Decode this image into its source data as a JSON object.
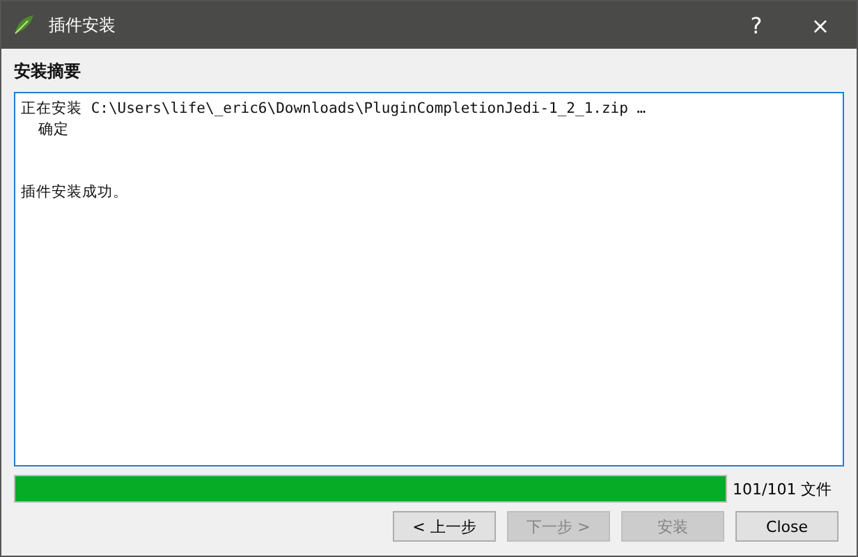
{
  "window": {
    "title": "插件安装",
    "help": "?",
    "close": "×"
  },
  "heading": "安装摘要",
  "log": [
    "正在安装 C:\\Users\\life\\_eric6\\Downloads\\PluginCompletionJedi-1_2_1.zip …",
    "  确定"
  ],
  "result": "插件安装成功。",
  "progress": {
    "level": 1,
    "reading": "101/101 文件"
  },
  "buttons": [
    {
      "label": "< 上一步",
      "disabled": false
    },
    {
      "label": "下一步 >",
      "disabled": true
    },
    {
      "label": "安装",
      "disabled": true
    },
    {
      "label": "Close",
      "disabled": false
    }
  ]
}
